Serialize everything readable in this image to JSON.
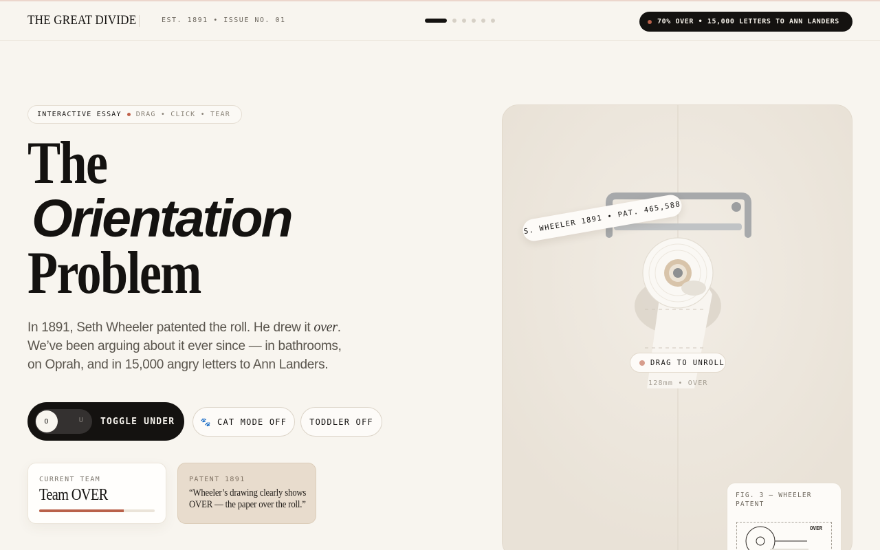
{
  "header": {
    "brand": "THE GREAT DIVIDE",
    "edition": "EST. 1891 • ISSUE NO. 01",
    "progress": {
      "current": 1,
      "total": 6
    },
    "stat": "70% OVER • 15,000 LETTERS TO ANN LANDERS"
  },
  "hero": {
    "eyebrow_main": "INTERACTIVE ESSAY",
    "eyebrow_sub": "DRAG • CLICK • TEAR",
    "title_line1": "The",
    "title_line2": "Orientation",
    "title_line3": "Problem",
    "lede_part1": "In 1891, Seth Wheeler patented the roll. He drew it ",
    "lede_emph": "over",
    "lede_part2": ". We’ve been arguing about it ever since — in bathrooms, on Oprah, and in 15,000 angry letters to Ann Landers."
  },
  "controls": {
    "toggle_knob": "O",
    "toggle_alt": "U",
    "toggle_label": "TOGGLE UNDER",
    "cat_icon": "paw-icon",
    "cat_glyph": "🐾",
    "cat_label": "CAT MODE OFF",
    "toddler_label": "TODDLER OFF"
  },
  "cards": {
    "team_label": "CURRENT TEAM",
    "team_value": "Team OVER",
    "team_progress": 0.73,
    "patent_label": "PATENT 1891",
    "patent_quote": "“Wheeler’s drawing clearly shows OVER — the paper over the roll.”"
  },
  "stage": {
    "patent_tag": "S. WHEELER 1891 • PAT. 465,588",
    "drag_label": "DRAG TO UNROLL",
    "measure": "128mm • OVER",
    "fig_caption": "FIG. 3 — WHEELER PATENT",
    "fig_over": "OVER"
  },
  "colors": {
    "background": "#f8f5ef",
    "ink": "#141210",
    "accent": "#b9614a",
    "patent_card": "#e8dccd"
  }
}
